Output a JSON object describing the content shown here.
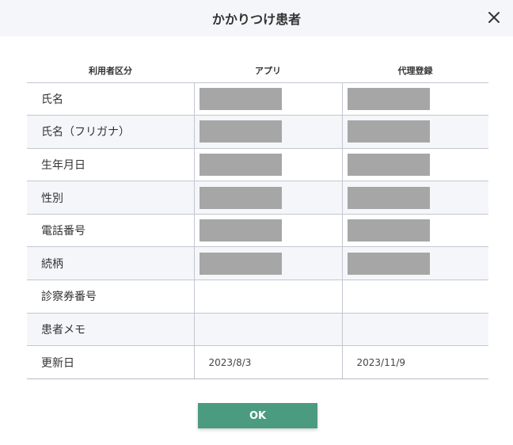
{
  "dialog": {
    "title": "かかりつけ患者",
    "close_icon": "close-icon"
  },
  "table": {
    "headers": [
      "利用者区分",
      "アプリ",
      "代理登録"
    ],
    "rows": [
      {
        "label": "氏名",
        "app": "",
        "proxy": "",
        "redacted": true
      },
      {
        "label": "氏名（フリガナ）",
        "app": "",
        "proxy": "",
        "redacted": true
      },
      {
        "label": "生年月日",
        "app": "",
        "proxy": "",
        "redacted": true
      },
      {
        "label": "性別",
        "app": "",
        "proxy": "",
        "redacted": true
      },
      {
        "label": "電話番号",
        "app": "",
        "proxy": "",
        "redacted": true
      },
      {
        "label": "続柄",
        "app": "",
        "proxy": "",
        "redacted": true
      },
      {
        "label": "診察券番号",
        "app": "",
        "proxy": "",
        "redacted": false
      },
      {
        "label": "患者メモ",
        "app": "",
        "proxy": "",
        "redacted": false
      },
      {
        "label": "更新日",
        "app": "2023/8/3",
        "proxy": "2023/11/9",
        "redacted": false
      }
    ]
  },
  "footer": {
    "ok_label": "OK"
  },
  "colors": {
    "header_bg": "#f5f6f9",
    "row_alt_bg": "#f5f6fa",
    "redaction": "#a6a6a6",
    "ok_button": "#4b9b81",
    "border": "#c4c7d0"
  }
}
